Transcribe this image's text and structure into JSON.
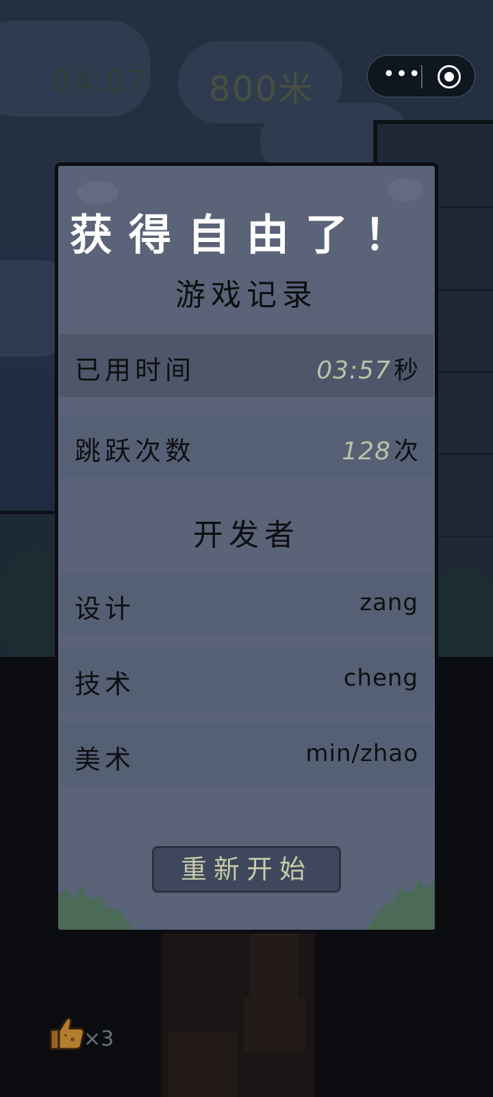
{
  "hud": {
    "time": "04:07",
    "distance": "800米",
    "lives": "×3"
  },
  "capsule": {
    "more_icon": "more-dots-icon",
    "close_icon": "record-circle-icon"
  },
  "dialog": {
    "title": "获得自由了！",
    "record_heading": "游戏记录",
    "stats": [
      {
        "label": "已用时间",
        "value": "03:57",
        "unit": "秒"
      },
      {
        "label": "跳跃次数",
        "value": "128",
        "unit": "次"
      }
    ],
    "dev_heading": "开发者",
    "developers": [
      {
        "role": "设计",
        "name": "zang"
      },
      {
        "role": "技术",
        "name": "cheng"
      },
      {
        "role": "美术",
        "name": "min/zhao"
      }
    ],
    "restart_label": "重新开始"
  },
  "colors": {
    "dialog_bg": "#5a6378",
    "row_dark": "#4e566a",
    "row_light": "#566075",
    "stat_number": "#b9c2a6",
    "button_bg": "#3e475c",
    "button_text": "#c7cba9"
  }
}
